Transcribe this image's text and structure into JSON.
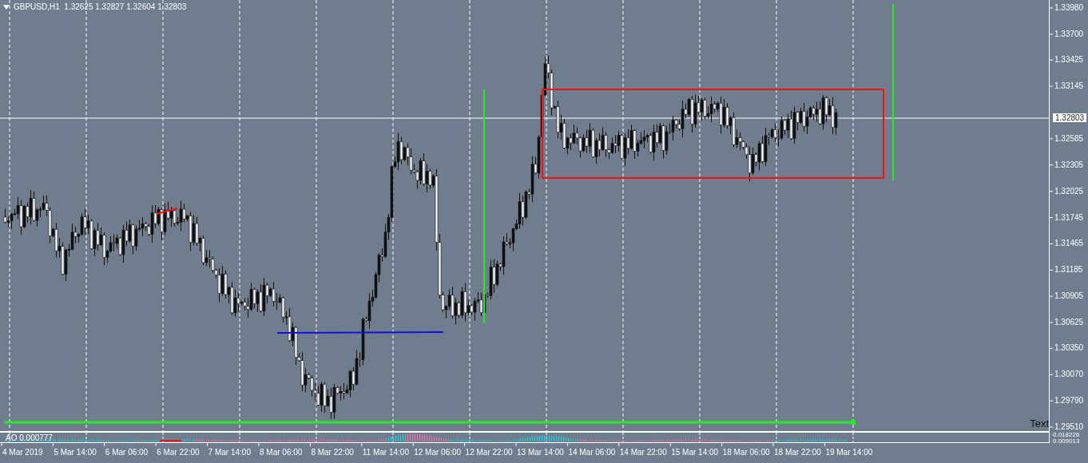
{
  "chart_header": {
    "text": "GBPUSD,H1  1.32625 1.32827 1.32604 1.32803"
  },
  "price_axis": {
    "labels": [
      "1.33980",
      "1.33700",
      "1.33425",
      "1.33145",
      "1.32585",
      "1.32305",
      "1.32025",
      "1.31745",
      "1.31465",
      "1.31185",
      "1.30905",
      "1.30625",
      "1.30350",
      "1.30070",
      "1.29790",
      "1.29510"
    ],
    "current_price": "1.32803"
  },
  "text_object": "Text",
  "indicator": {
    "label": "AO 0.000777",
    "axis_labels": [
      "0.018226",
      "0.009013"
    ]
  },
  "time_axis": {
    "labels": [
      "4 Mar 2019",
      "5 Mar 14:00",
      "6 Mar 06:00",
      "6 Mar 22:00",
      "7 Mar 14:00",
      "8 Mar 06:00",
      "8 Mar 22:00",
      "11 Mar 14:00",
      "12 Mar 06:00",
      "12 Mar 22:00",
      "13 Mar 14:00",
      "14 Mar 06:00",
      "14 Mar 22:00",
      "15 Mar 14:00",
      "18 Mar 06:00",
      "18 Mar 22:00",
      "19 Mar 14:00"
    ]
  }
}
